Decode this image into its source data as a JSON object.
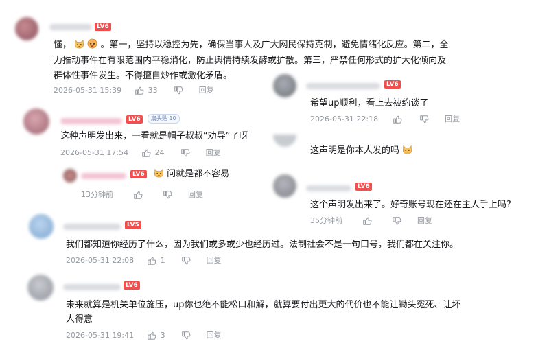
{
  "colors": {
    "level_badge": "#f14e4e",
    "meta_text": "#9499a0",
    "body_text": "#18191c"
  },
  "comments": [
    {
      "level": "LV6",
      "text_lines": [
        "懂，",
        "。第一，坚持以稳控为先，确保当事人及广大网民保持克制，避免情绪化反应。第二，全",
        "力推动事件在有限范围内平稳消化，防止舆情持续发酵或扩散。第三，严禁任何形式的扩大化倾向及",
        "群体性事件发生。不得擅自炒作或激化矛盾。"
      ],
      "date": "2026-05-31 15:39",
      "likes": "33",
      "reply_label": "回复",
      "emojis": [
        "cat-emoji",
        "cat-emoji"
      ]
    },
    {
      "level": "LV6",
      "badge": "扇头贴 10",
      "text": "这种声明发出来，一看就是帽子叔叔“劝导”了呀",
      "date": "2026-05-31 17:54",
      "likes": "24",
      "reply_label": "回复",
      "reply": {
        "level": "LV6",
        "text": "问就是都不容易",
        "time": "13分钟前",
        "reply_label": "回复"
      }
    },
    {
      "level": "LV5",
      "text": "我们都知道你经历了什么，因为我们或多或少也经历过。法制社会不是一句口号，我们都在关注你。",
      "date": "2026-05-31 22:08",
      "likes": "1",
      "reply_label": "回复"
    },
    {
      "level": "LV6",
      "text_lines": [
        "未来就算是机关单位施压，up你也绝不能松口和解，就算要付出更大的代价也不能让锄头冤死、让坏",
        "人得意"
      ],
      "date": "2026-05-31 19:41",
      "likes": "3",
      "reply_label": "回复"
    }
  ],
  "right_comments": [
    {
      "level": "LV6",
      "text": "希望up顺利，看上去被约谈了",
      "date": "2026-05-31 22:18",
      "reply_label": "回复"
    },
    {
      "text": "这声明是你本人发的吗",
      "emoji": "cat-emoji"
    },
    {
      "level": "LV6",
      "text": "这个声明发出来了。好奇账号现在还在主人手上吗?",
      "time": "35分钟前",
      "reply_label": "回复"
    }
  ]
}
